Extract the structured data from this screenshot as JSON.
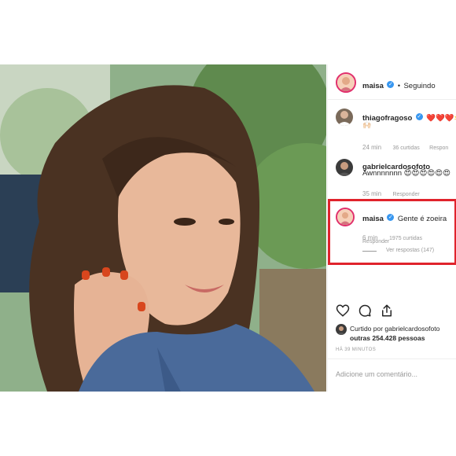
{
  "colors": {
    "accent": "#3897f0",
    "highlight": "#e0232c",
    "story_ring": "#e1306c"
  },
  "photo": {
    "name": "selfie-photo"
  },
  "header": {
    "username": "maisa",
    "verified_icon": "verified-badge-icon",
    "separator": "•",
    "follow_status": "Seguindo"
  },
  "comments": [
    {
      "username": "thiagofragoso",
      "verified": true,
      "text": "❤️❤️❤️🌟",
      "text2": "🙌🏻",
      "time": "24 min",
      "likes": "36 curtidas",
      "reply": "Respon"
    },
    {
      "username": "gabrielcardosofoto",
      "verified": false,
      "text": "Awnnnnnnn 😍😍😍😍😍😍",
      "time": "35 min",
      "reply": "Responder"
    },
    {
      "username": "maisa",
      "verified": true,
      "text": "Gente é zoeira",
      "time": "6 min",
      "likes": "1975 curtidas",
      "reply": "Responder",
      "view_replies": "Ver respostas (147)"
    }
  ],
  "actions": {
    "like_icon": "heart-icon",
    "comment_icon": "comment-icon",
    "share_icon": "share-icon"
  },
  "likes": {
    "line1": "Curtido por gabrielcardosofoto",
    "line2": "outras 254.428 pessoas"
  },
  "timestamp": "HÁ 39 MINUTOS",
  "add_comment": {
    "placeholder": "Adicione um comentário..."
  }
}
